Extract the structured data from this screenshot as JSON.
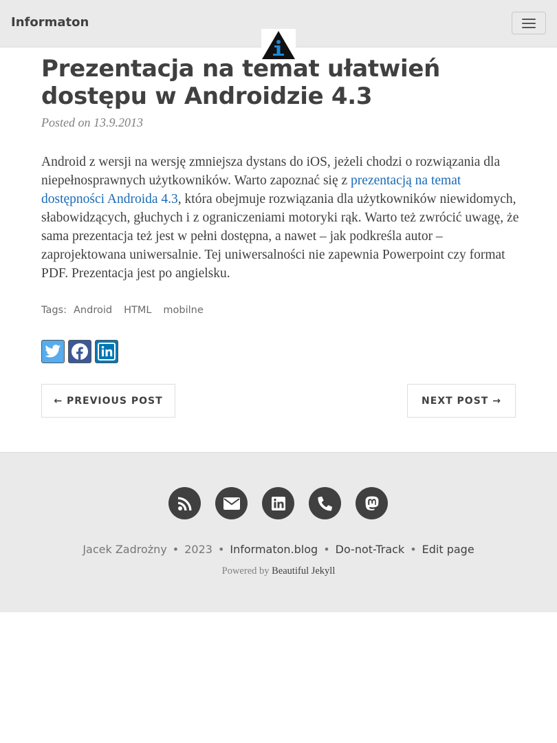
{
  "navbar": {
    "brand": "Informaton",
    "menu_toggle_icon": "hamburger-icon",
    "logo_icon": "info-triangle-logo"
  },
  "post": {
    "title": "Prezentacja na temat ułatwień dostępu w Androidzie 4.3",
    "meta": "Posted on 13.9.2013",
    "body_before_link": "Android z wersji na wersję zmniejsza dystans do iOS, jeżeli chodzi o rozwiązania dla niepełnosprawnych użytkowników. Warto zapoznać się z ",
    "link_text": "prezentacją na temat dostępności Androida 4.3",
    "body_after_link": ", która obejmuje rozwiązania dla użytkowników niewidomych, słabowidzących, głuchych i z ograniczeniami motoryki rąk. Warto też zwrócić uwagę, że sama prezentacja też jest w pełni dostępna, a nawet – jak podkreśla autor – zaprojektowana uniwersalnie. Tej uniwersalności nie zapewnia Powerpoint czy format PDF. Prezentacja jest po angielsku.",
    "link_color": "#1a6bb8"
  },
  "tags": {
    "label": "Tags:",
    "items": [
      "Android",
      "HTML",
      "mobilne"
    ]
  },
  "share": {
    "twitter_icon": "twitter-icon",
    "facebook_icon": "facebook-icon",
    "linkedin_icon": "linkedin-icon",
    "colors": {
      "twitter": "#55acee",
      "facebook": "#3b5998",
      "linkedin": "#0077b5"
    }
  },
  "pager": {
    "previous": "← PREVIOUS POST",
    "next": "NEXT POST →"
  },
  "footer": {
    "social_icons": [
      "rss-icon",
      "envelope-icon",
      "linkedin-icon",
      "phone-icon",
      "mastodon-icon"
    ],
    "author": "Jacek Zadrożny",
    "year": "2023",
    "site": "Informaton.blog",
    "dnt": "Do-not-Track",
    "edit": "Edit page",
    "powered_prefix": "Powered by",
    "powered_link": "Beautiful Jekyll"
  }
}
